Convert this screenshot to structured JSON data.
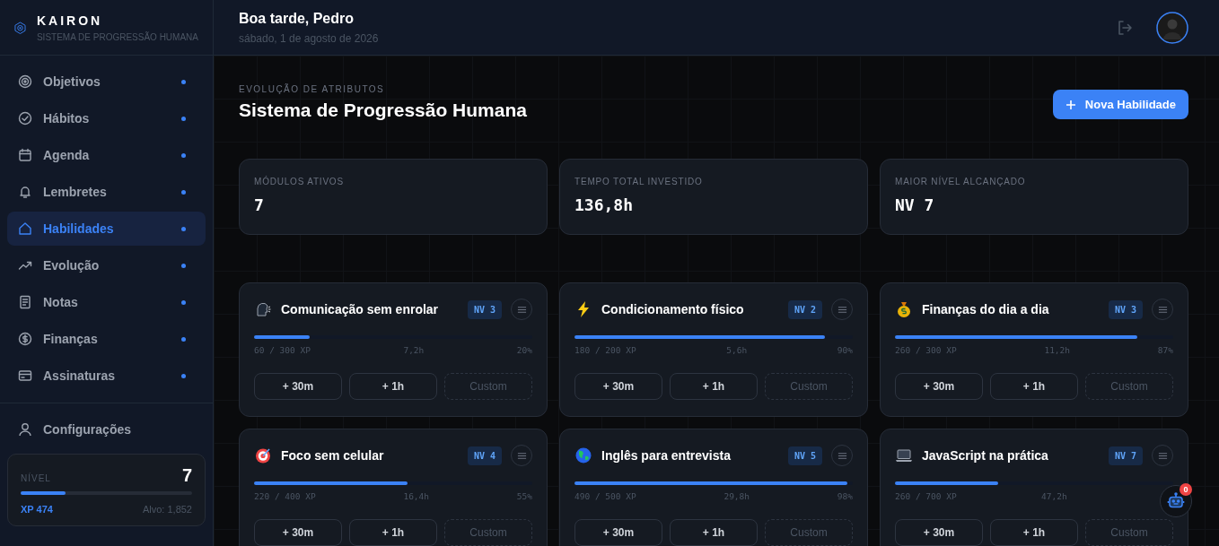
{
  "brand": {
    "name": "KAIRON",
    "tagline": "SISTEMA DE PROGRESSÃO HUMANA"
  },
  "sidebar": {
    "items": [
      {
        "label": "Objetivos",
        "selected": false
      },
      {
        "label": "Hábitos",
        "selected": false
      },
      {
        "label": "Agenda",
        "selected": false
      },
      {
        "label": "Lembretes",
        "selected": false
      },
      {
        "label": "Habilidades",
        "selected": true
      },
      {
        "label": "Evolução",
        "selected": false
      },
      {
        "label": "Notas",
        "selected": false
      },
      {
        "label": "Finanças",
        "selected": false
      },
      {
        "label": "Assinaturas",
        "selected": false
      }
    ],
    "settings": "Configurações",
    "level_card": {
      "label": "NÍVEL",
      "value": "7",
      "level": 0.26,
      "xp": "XP 474",
      "target": "Alvo: 1,852"
    }
  },
  "header": {
    "greeting": "Boa tarde, Pedro",
    "date": "sábado, 1 de agosto de 2026"
  },
  "page": {
    "eyebrow": "EVOLUÇÃO DE ATRIBUTOS",
    "title": "Sistema de Progressão Humana",
    "new_button": "Nova Habilidade"
  },
  "stats": [
    {
      "label": "MÓDULOS ATIVOS",
      "value": "7"
    },
    {
      "label": "TEMPO TOTAL INVESTIDO",
      "value": "136,8h"
    },
    {
      "label": "MAIOR NÍVEL ALCANÇADO",
      "value": "NV 7"
    }
  ],
  "skills": [
    {
      "name": "Comunicação sem enrolar",
      "badge": "NV 3",
      "level": 0.2,
      "xp": "60 / 300 XP",
      "time": "7,2h",
      "percent": "20%",
      "buttons": [
        "+ 30m",
        "+ 1h",
        "Custom"
      ]
    },
    {
      "name": "Condicionamento físico",
      "badge": "NV 2",
      "level": 0.9,
      "xp": "180 / 200 XP",
      "time": "5,6h",
      "percent": "90%",
      "buttons": [
        "+ 30m",
        "+ 1h",
        "Custom"
      ]
    },
    {
      "name": "Finanças do dia a dia",
      "badge": "NV 3",
      "level": 0.87,
      "xp": "260 / 300 XP",
      "time": "11,2h",
      "percent": "87%",
      "buttons": [
        "+ 30m",
        "+ 1h",
        "Custom"
      ]
    },
    {
      "name": "Foco sem celular",
      "badge": "NV 4",
      "level": 0.55,
      "xp": "220 / 400 XP",
      "time": "16,4h",
      "percent": "55%",
      "buttons": [
        "+ 30m",
        "+ 1h",
        "Custom"
      ]
    },
    {
      "name": "Inglês para entrevista",
      "badge": "NV 5",
      "level": 0.98,
      "xp": "490 / 500 XP",
      "time": "29,8h",
      "percent": "98%",
      "buttons": [
        "+ 30m",
        "+ 1h",
        "Custom"
      ]
    },
    {
      "name": "JavaScript na prática",
      "badge": "NV 7",
      "level": 0.37,
      "xp": "260 / 700 XP",
      "time": "47,2h",
      "buttons": [
        "+ 30m",
        "+ 1h",
        "Custom"
      ]
    }
  ],
  "assistant": {
    "badge": "0"
  }
}
